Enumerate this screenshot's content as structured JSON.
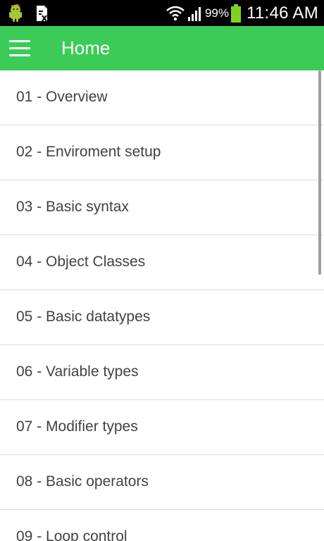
{
  "status_bar": {
    "battery_percent": "99%",
    "time": "11:46 AM",
    "icons": [
      "android-icon",
      "document-x-icon",
      "wifi-icon",
      "signal-icon",
      "battery-icon"
    ],
    "colors": {
      "battery": "#7ed321",
      "android": "#a4c639"
    }
  },
  "app_bar": {
    "title": "Home",
    "menu_icon": "hamburger-menu-icon",
    "color": "#3bcc57"
  },
  "list": {
    "items": [
      {
        "label": "01 - Overview"
      },
      {
        "label": "02 - Enviroment setup"
      },
      {
        "label": "03 - Basic syntax"
      },
      {
        "label": "04 - Object Classes"
      },
      {
        "label": "05 - Basic datatypes"
      },
      {
        "label": "06 - Variable types"
      },
      {
        "label": "07 - Modifier types"
      },
      {
        "label": "08 - Basic operators"
      },
      {
        "label": "09 - Loop control"
      }
    ]
  }
}
